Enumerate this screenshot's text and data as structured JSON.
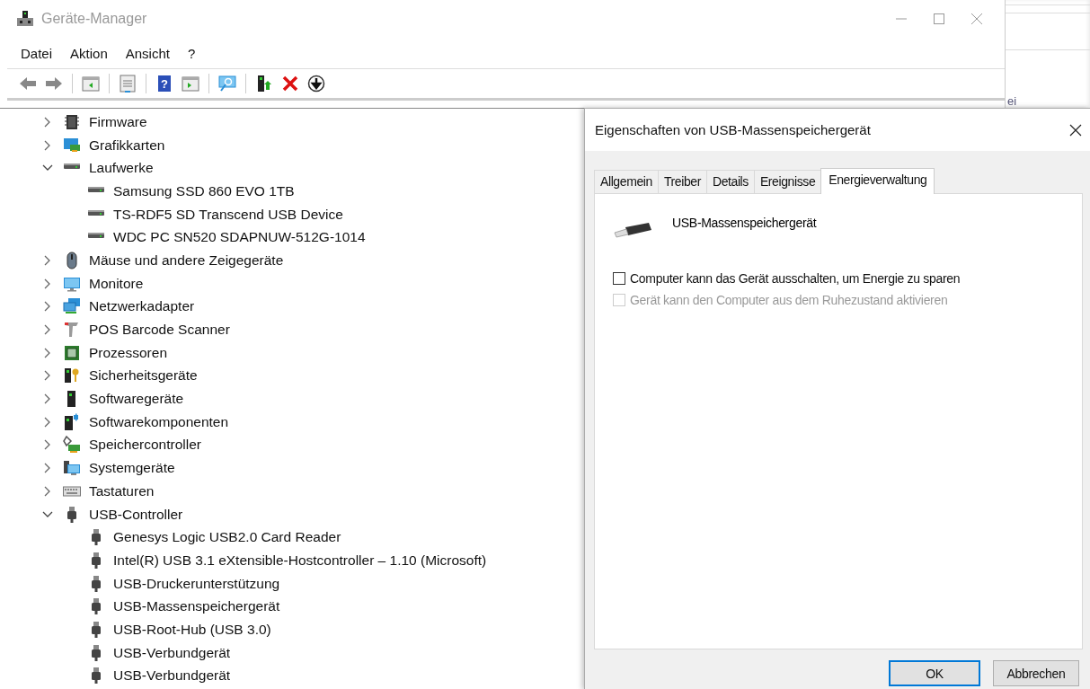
{
  "window": {
    "title": "Geräte-Manager"
  },
  "menu": [
    "Datei",
    "Aktion",
    "Ansicht",
    "?"
  ],
  "toolbar": {
    "help_glyph": "?"
  },
  "background_window": {
    "fragment": "ei"
  },
  "tree": [
    {
      "label": "Firmware",
      "kind": "chip",
      "expanded": false
    },
    {
      "label": "Grafikkarten",
      "kind": "graphics",
      "expanded": false
    },
    {
      "label": "Laufwerke",
      "kind": "drive",
      "expanded": true,
      "children": [
        {
          "label": "Samsung SSD 860 EVO 1TB",
          "kind": "drive"
        },
        {
          "label": "TS-RDF5 SD  Transcend USB Device",
          "kind": "drive"
        },
        {
          "label": "WDC PC SN520 SDAPNUW-512G-1014",
          "kind": "drive"
        }
      ]
    },
    {
      "label": "Mäuse und andere Zeigegeräte",
      "kind": "mouse",
      "expanded": false
    },
    {
      "label": "Monitore",
      "kind": "monitor",
      "expanded": false
    },
    {
      "label": "Netzwerkadapter",
      "kind": "network",
      "expanded": false
    },
    {
      "label": "POS Barcode Scanner",
      "kind": "scanner",
      "expanded": false
    },
    {
      "label": "Prozessoren",
      "kind": "processor",
      "expanded": false
    },
    {
      "label": "Sicherheitsgeräte",
      "kind": "security",
      "expanded": false
    },
    {
      "label": "Softwaregeräte",
      "kind": "tower",
      "expanded": false
    },
    {
      "label": "Softwarekomponenten",
      "kind": "component",
      "expanded": false
    },
    {
      "label": "Speichercontroller",
      "kind": "storage",
      "expanded": false
    },
    {
      "label": "Systemgeräte",
      "kind": "system",
      "expanded": false
    },
    {
      "label": "Tastaturen",
      "kind": "keyboard",
      "expanded": false
    },
    {
      "label": "USB-Controller",
      "kind": "usb",
      "expanded": true,
      "children": [
        {
          "label": "Genesys Logic USB2.0 Card Reader",
          "kind": "usb"
        },
        {
          "label": "Intel(R) USB 3.1 eXtensible-Hostcontroller – 1.10 (Microsoft)",
          "kind": "usb"
        },
        {
          "label": "USB-Druckerunterstützung",
          "kind": "usb"
        },
        {
          "label": "USB-Massenspeichergerät",
          "kind": "usb"
        },
        {
          "label": "USB-Root-Hub (USB 3.0)",
          "kind": "usb"
        },
        {
          "label": "USB-Verbundgerät",
          "kind": "usb"
        },
        {
          "label": "USB-Verbundgerät",
          "kind": "usb"
        }
      ]
    }
  ],
  "dialog": {
    "title": "Eigenschaften von USB-Massenspeichergerät",
    "tabs": [
      {
        "label": "Allgemein",
        "selected": false
      },
      {
        "label": "Treiber",
        "selected": false
      },
      {
        "label": "Details",
        "selected": false
      },
      {
        "label": "Ereignisse",
        "selected": false
      },
      {
        "label": "Energieverwaltung",
        "selected": true
      }
    ],
    "device_name": "USB-Massenspeichergerät",
    "options": [
      {
        "label": "Computer kann das Gerät ausschalten, um Energie zu sparen",
        "checked": false,
        "disabled": false
      },
      {
        "label": "Gerät kann den Computer aus dem Ruhezustand aktivieren",
        "checked": false,
        "disabled": true
      }
    ],
    "buttons": [
      {
        "label": "OK",
        "default": true
      },
      {
        "label": "Abbrechen",
        "default": false
      }
    ]
  }
}
